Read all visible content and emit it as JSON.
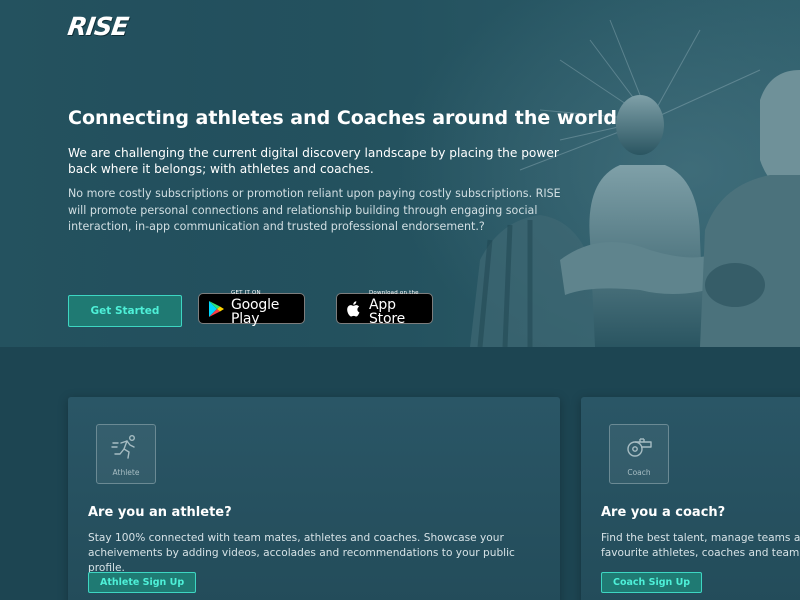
{
  "brand": {
    "logo_text": "RISE"
  },
  "hero": {
    "title": "Connecting athletes and Coaches around the world",
    "lead": "We are challenging the current digital discovery landscape by placing the power back where it belongs; with athletes and coaches.",
    "body": "No more costly subscriptions or promotion reliant upon paying costly subscriptions. RISE will promote personal connections and relationship building through engaging social interaction, in-app communication and trusted professional endorsement.?",
    "cta_label": "Get Started",
    "google_play": {
      "small": "GET IT ON",
      "big": "Google Play"
    },
    "app_store": {
      "small": "Download on the",
      "big": "App Store"
    }
  },
  "cards": {
    "athlete": {
      "tile_label": "Athlete",
      "title": "Are you an athlete?",
      "description": "Stay 100% connected with team mates, athletes and coaches. Showcase your acheivements by adding videos, accolades and recommendations to your public profile.",
      "button_label": "Athlete Sign Up",
      "icon": "running-athlete-icon"
    },
    "coach": {
      "tile_label": "Coach",
      "title": "Are you a coach?",
      "description": "Find the best talent, manage teams and",
      "description_line2": "favourite athletes, coaches and team ma",
      "button_label": "Coach Sign Up",
      "icon": "whistle-icon"
    }
  },
  "colors": {
    "background": "#1d4552",
    "accent": "#3dd6c2",
    "button_fill": "#1f7a73"
  }
}
